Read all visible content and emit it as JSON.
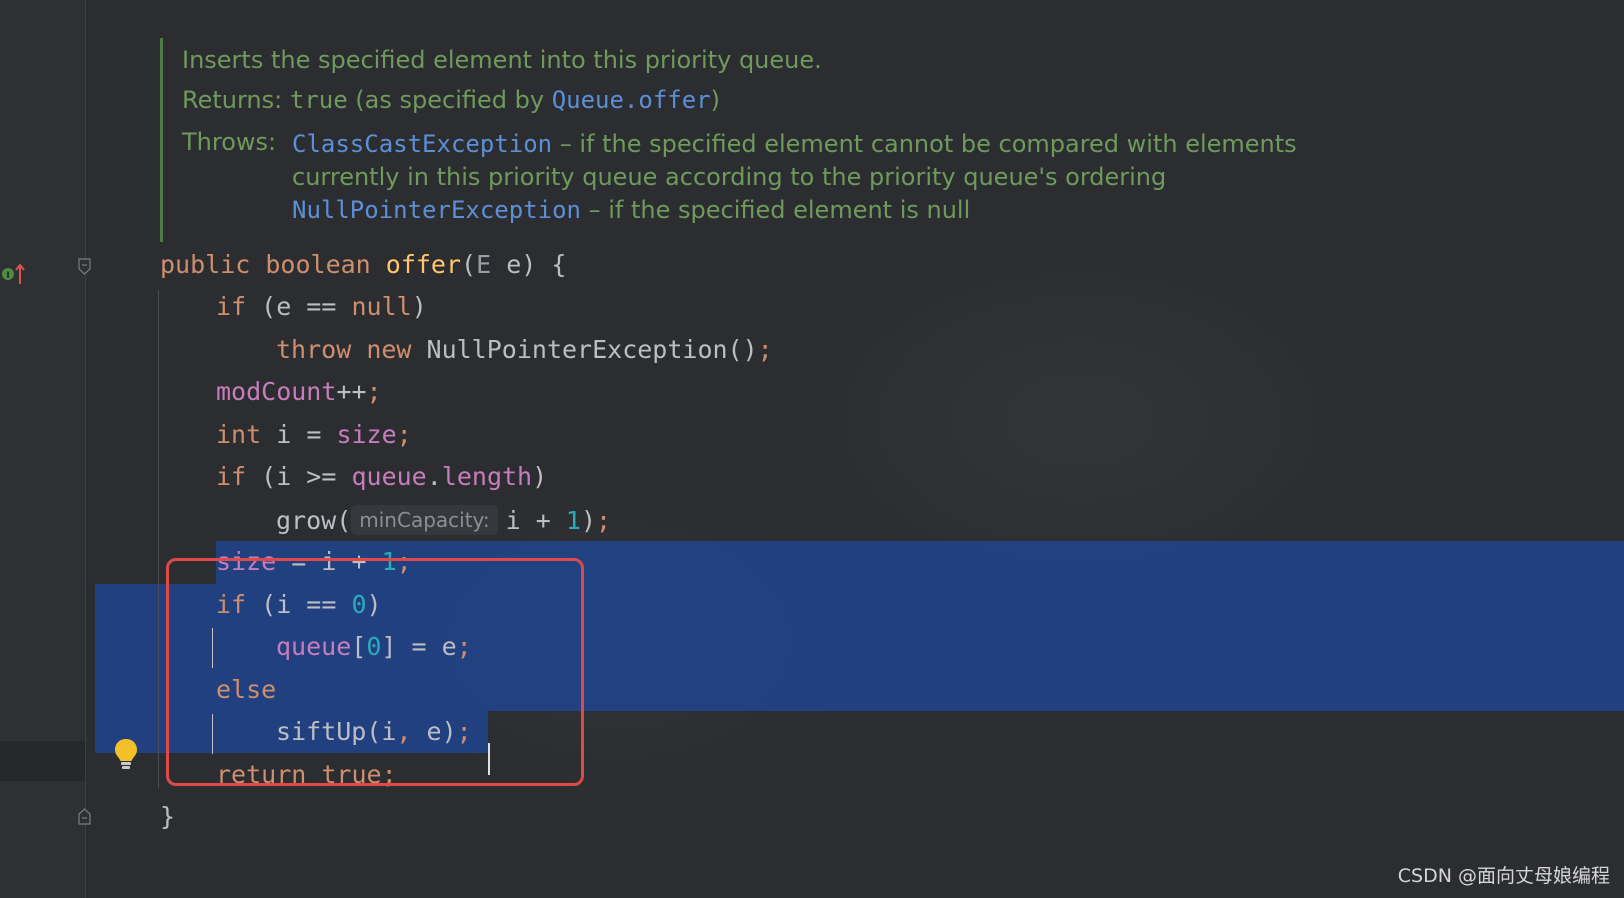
{
  "doc": {
    "line1": "Inserts the specified element into this priority queue.",
    "returns_label": "Returns:",
    "returns_true": "true",
    "returns_mid": " (as specified by ",
    "returns_ref": "Queue.offer",
    "returns_end": ")",
    "throws_label": "Throws:",
    "throws_ex1": "ClassCastException",
    "throws_ex1_desc": " – if the specified element cannot be compared with elements",
    "throws_ex1_desc2": "currently in this priority queue according to the priority queue's ordering",
    "throws_ex2": "NullPointerException",
    "throws_ex2_desc": " – if the specified element is null"
  },
  "code": {
    "l1_public": "public ",
    "l1_boolean": "boolean ",
    "l1_offer": "offer",
    "l1_paren": "(",
    "l1_E": "E",
    "l1_rest": " e) {",
    "l2_if": "if ",
    "l2_rest": "(e == ",
    "l2_null": "null",
    "l2_close": ")",
    "l3_throw": "throw ",
    "l3_new": "new ",
    "l3_npe": "NullPointerException()",
    "l3_sc": ";",
    "l4_modCount": "modCount",
    "l4_inc": "++",
    "l4_sc": ";",
    "l5_int": "int ",
    "l5_i": "i = ",
    "l5_size": "size",
    "l5_sc": ";",
    "l6_if": "if ",
    "l6_open": "(i >= ",
    "l6_queue": "queue",
    "l6_dot": ".",
    "l6_length": "length",
    "l6_close": ")",
    "l7_grow": "grow(",
    "l7_hint": "minCapacity:",
    "l7_arg": "i + ",
    "l7_one": "1",
    "l7_close": ")",
    "l7_sc": ";",
    "l8_size": "size",
    "l8_eq": " = i + ",
    "l8_one": "1",
    "l8_sc": ";",
    "l9_if": "if ",
    "l9_open": "(i == ",
    "l9_zero": "0",
    "l9_close": ")",
    "l10_queue": "queue",
    "l10_ob": "[",
    "l10_zero": "0",
    "l10_rest": "] = e",
    "l10_sc": ";",
    "l11_else": "else",
    "l12_siftUp": "siftUp(i",
    "l12_comma": ",",
    "l12_rest": " e)",
    "l12_sc": ";",
    "l13_return": "return ",
    "l13_true": "true",
    "l13_sc": ";",
    "l14_brace": "}"
  },
  "watermark": "CSDN @面向丈母娘编程",
  "colors": {
    "background": "#2b2d30",
    "selection": "#214283",
    "keyword": "#cf8e6d",
    "field": "#c77dbb",
    "number": "#2aacb8",
    "doc_text": "#6f9a5c",
    "doc_link": "#5c8fd6",
    "highlight_box": "#e0494a"
  },
  "icons": [
    "implements-interface-icon",
    "fold-start-icon",
    "fold-end-icon",
    "lightbulb-icon"
  ]
}
